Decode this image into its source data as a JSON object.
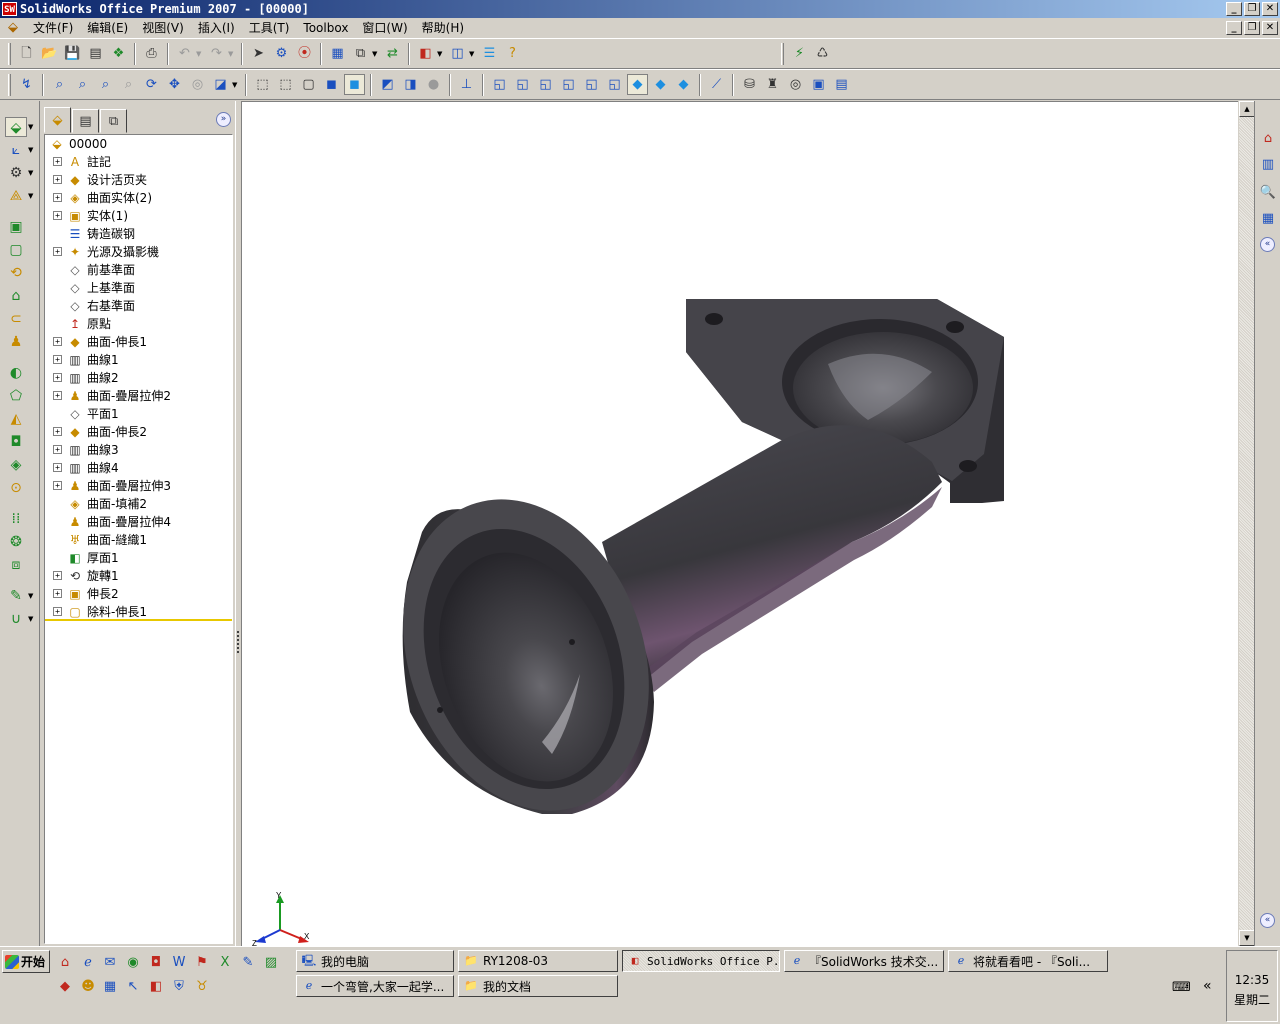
{
  "window": {
    "title": "SolidWorks Office Premium 2007 - [00000]",
    "app_icon_text": "SW"
  },
  "menubar": {
    "items": [
      "文件(F)",
      "编辑(E)",
      "视图(V)",
      "插入(I)",
      "工具(T)",
      "Toolbox",
      "窗口(W)",
      "帮助(H)"
    ]
  },
  "feature_tree": {
    "root": "00000",
    "items": [
      {
        "label": "註記",
        "icon": "annotation-icon"
      },
      {
        "label": "设计活页夹",
        "icon": "design-binder-icon"
      },
      {
        "label": "曲面实体(2)",
        "icon": "surface-bodies-icon"
      },
      {
        "label": "实体(1)",
        "icon": "solid-bodies-icon"
      },
      {
        "label": "铸造碳钢",
        "icon": "material-icon"
      },
      {
        "label": "光源及攝影機",
        "icon": "lights-cameras-icon"
      },
      {
        "label": "前基準面",
        "icon": "plane-icon"
      },
      {
        "label": "上基準面",
        "icon": "plane-icon"
      },
      {
        "label": "右基準面",
        "icon": "plane-icon"
      },
      {
        "label": "原點",
        "icon": "origin-icon"
      },
      {
        "label": "曲面-伸長1",
        "icon": "surface-extrude-icon"
      },
      {
        "label": "曲線1",
        "icon": "curve-icon"
      },
      {
        "label": "曲線2",
        "icon": "curve-icon"
      },
      {
        "label": "曲面-疊層拉伸2",
        "icon": "surface-loft-icon"
      },
      {
        "label": "平面1",
        "icon": "plane-icon"
      },
      {
        "label": "曲面-伸長2",
        "icon": "surface-extrude-icon"
      },
      {
        "label": "曲線3",
        "icon": "curve-icon"
      },
      {
        "label": "曲線4",
        "icon": "curve-icon"
      },
      {
        "label": "曲面-疊層拉伸3",
        "icon": "surface-loft-icon"
      },
      {
        "label": "曲面-填補2",
        "icon": "surface-fill-icon"
      },
      {
        "label": "曲面-疊層拉伸4",
        "icon": "surface-loft-icon"
      },
      {
        "label": "曲面-縫織1",
        "icon": "surface-knit-icon"
      },
      {
        "label": "厚面1",
        "icon": "thicken-icon"
      },
      {
        "label": "旋轉1",
        "icon": "revolve-icon"
      },
      {
        "label": "伸長2",
        "icon": "extrude-icon"
      },
      {
        "label": "除料-伸長1",
        "icon": "cut-extrude-icon"
      }
    ]
  },
  "triad": {
    "x": "X",
    "y": "Y",
    "z": "Z"
  },
  "taskbar": {
    "start_label": "开始",
    "tasks": [
      {
        "label": "我的电脑",
        "icon": "computer-icon"
      },
      {
        "label": "RY1208-03",
        "icon": "folder-icon"
      },
      {
        "label": "SolidWorks Office P...",
        "icon": "solidworks-icon"
      },
      {
        "label": "『SolidWorks 技术交...",
        "icon": "ie-icon"
      },
      {
        "label": "将就看看吧 - 『Soli...",
        "icon": "ie-icon"
      },
      {
        "label": "一个弯管,大家一起学...",
        "icon": "ie-icon"
      },
      {
        "label": "我的文档",
        "icon": "folder-icon"
      }
    ],
    "clock": "12:35",
    "weekday": "星期二"
  },
  "colors": {
    "title_start": "#0a246a",
    "title_end": "#a6caf0",
    "chrome": "#d4d0c8",
    "model_body": "#3e3d42",
    "model_highlight": "#7a5f7e",
    "rollback_bar": "#e8c800"
  }
}
